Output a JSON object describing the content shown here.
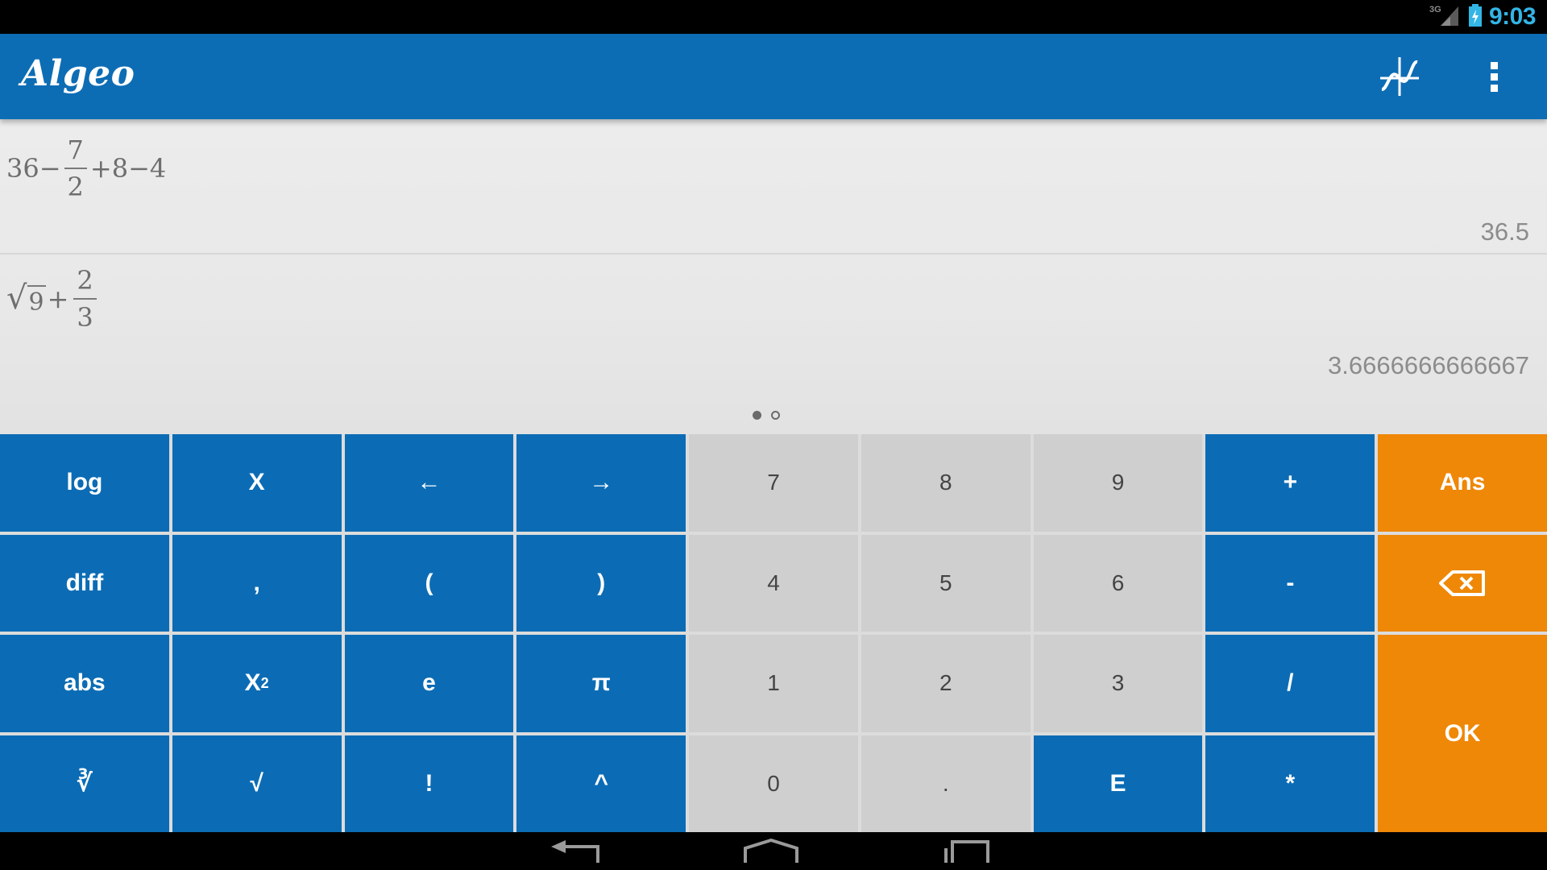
{
  "status_bar": {
    "network_label": "3G",
    "time": "9:03",
    "icons": [
      "signal-icon",
      "battery-icon"
    ]
  },
  "action_bar": {
    "title": "Algeo",
    "actions": [
      "graph-icon",
      "overflow-menu-icon"
    ]
  },
  "history": [
    {
      "expression": {
        "lead": "36−",
        "frac_num": "7",
        "frac_den": "2",
        "tail": "+8−4"
      },
      "result": "36.5"
    },
    {
      "expression": {
        "sqrt_symbol": "√",
        "radicand": "9",
        "op": "+",
        "frac_num": "2",
        "frac_den": "3"
      },
      "result": "3.6666666666667"
    }
  ],
  "pager": {
    "pages": 2,
    "active": 1
  },
  "keypad": {
    "rows": [
      [
        "log",
        "X",
        "←",
        "→",
        "7",
        "8",
        "9",
        "+",
        "Ans"
      ],
      [
        "diff",
        ",",
        "(",
        ")",
        "4",
        "5",
        "6",
        "-",
        "⌫"
      ],
      [
        "abs",
        "X²",
        "e",
        "π",
        "1",
        "2",
        "3",
        "/",
        "OK"
      ],
      [
        "∛",
        "√",
        "!",
        "^",
        "0",
        ".",
        "E",
        "*"
      ]
    ],
    "key_labels": {
      "log": "log",
      "x": "X",
      "left": "←",
      "right": "→",
      "seven": "7",
      "eight": "8",
      "nine": "9",
      "plus": "+",
      "ans": "Ans",
      "diff": "diff",
      "comma": ",",
      "lparen": "(",
      "rparen": ")",
      "four": "4",
      "five": "5",
      "six": "6",
      "minus": "-",
      "abs": "abs",
      "x_base": "X",
      "x_sup": "2",
      "e": "e",
      "pi": "π",
      "one": "1",
      "two": "2",
      "three": "3",
      "divide": "/",
      "ok": "OK",
      "cbrt": "∛",
      "sqrt": "√",
      "factorial": "!",
      "power": "^",
      "zero": "0",
      "dot": ".",
      "exp": "E",
      "multiply": "*"
    },
    "colors": {
      "blue": "#0b6cb5",
      "gray": "#cfcfcf",
      "orange": "#ef8707"
    }
  },
  "nav_bar": {
    "buttons": [
      "back-icon",
      "home-icon",
      "recents-icon"
    ]
  },
  "colors": {
    "action_bar": "#0d6db4",
    "status_time": "#33b5e5"
  }
}
